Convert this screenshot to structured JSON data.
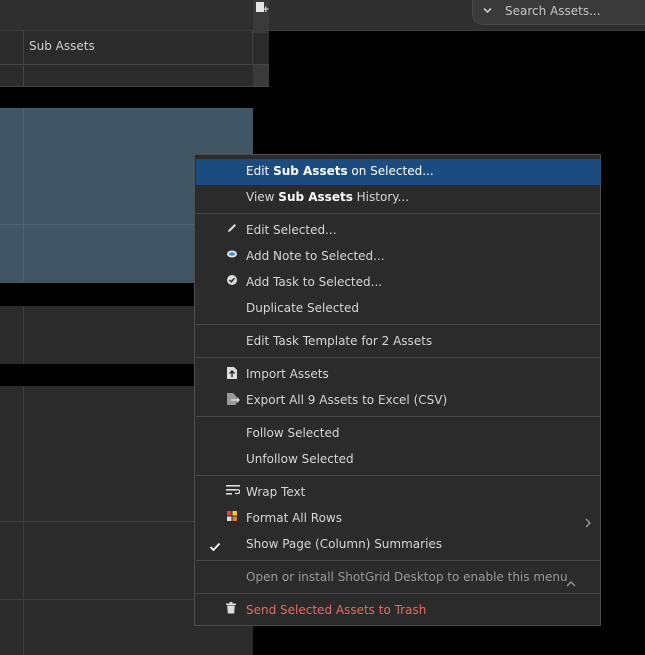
{
  "search": {
    "placeholder": "Search Assets...",
    "chevron_icon": "chevron-down-icon"
  },
  "grid": {
    "column_header": "Sub Assets",
    "add_column_icon": "add-column-icon"
  },
  "context_menu": {
    "items": [
      {
        "pre": "Edit ",
        "bold": "Sub Assets",
        "post": " on Selected...",
        "highlighted": true
      },
      {
        "pre": "View ",
        "bold": "Sub Assets",
        "post": " History..."
      },
      {
        "label": "Edit Selected...",
        "icon": "pencil-icon"
      },
      {
        "label": "Add Note to Selected...",
        "icon": "note-bubble-icon"
      },
      {
        "label": "Add Task to Selected...",
        "icon": "task-check-icon"
      },
      {
        "label": "Duplicate Selected"
      },
      {
        "label": "Edit Task Template for 2 Assets"
      },
      {
        "label": "Import Assets",
        "icon": "import-icon"
      },
      {
        "label": "Export All 9 Assets to Excel (CSV)",
        "icon": "export-icon"
      },
      {
        "label": "Follow Selected"
      },
      {
        "label": "Unfollow Selected"
      },
      {
        "label": "Wrap Text",
        "icon": "wrap-text-icon"
      },
      {
        "label": "Format All Rows",
        "icon": "format-grid-icon",
        "submenu_icon": "chevron-right-icon"
      },
      {
        "label": "Show Page (Column) Summaries",
        "checked": true,
        "check_icon": "checkmark-icon"
      },
      {
        "label": "Open or install ShotGrid Desktop to enable this menu",
        "disabled": true,
        "expand_icon": "chevron-up-icon"
      },
      {
        "label": "Send Selected Assets to Trash",
        "icon": "trash-icon",
        "danger": true
      }
    ]
  },
  "colors": {
    "menu_highlight": "#1c4b80",
    "selected_row": "#415665",
    "danger_text": "#e86a5c"
  }
}
